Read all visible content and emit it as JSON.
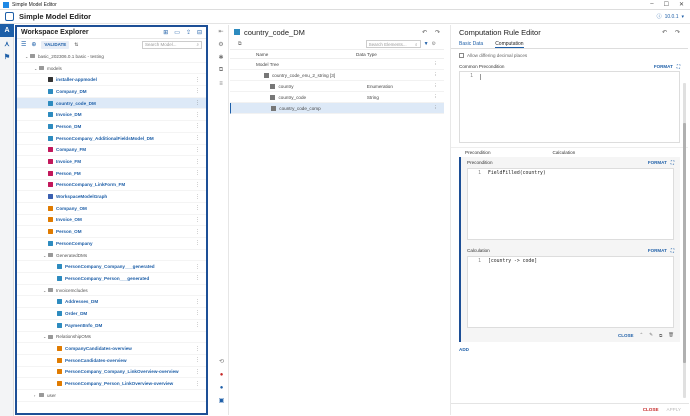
{
  "window": {
    "title": "Simple Model Editor"
  },
  "app": {
    "name": "Simple Model Editor",
    "version": "10.0.1"
  },
  "explorer": {
    "title": "Workspace Explorer",
    "validate_label": "VALIDATE",
    "search_placeholder": "Search Model...",
    "rows": [
      {
        "label": "basic_202306.0.1 basic - testing",
        "type": "folder",
        "depth": 0,
        "plain": true
      },
      {
        "label": "models",
        "type": "folder",
        "depth": 1,
        "plain": true
      },
      {
        "label": "installer-appmodel",
        "type": "app",
        "depth": 2
      },
      {
        "label": "Company_DM",
        "type": "dm",
        "depth": 2
      },
      {
        "label": "country_code_DM",
        "type": "dm",
        "depth": 2,
        "selected": true
      },
      {
        "label": "Invoice_DM",
        "type": "dm",
        "depth": 2
      },
      {
        "label": "Person_DM",
        "type": "dm",
        "depth": 2
      },
      {
        "label": "PersonCompany_AdditionalFieldsModel_DM",
        "type": "dm",
        "depth": 2
      },
      {
        "label": "Company_FM",
        "type": "fm",
        "depth": 2
      },
      {
        "label": "Invoice_FM",
        "type": "fm",
        "depth": 2
      },
      {
        "label": "Person_FM",
        "type": "fm",
        "depth": 2
      },
      {
        "label": "PersonCompany_LinkForm_FM",
        "type": "fm",
        "depth": 2
      },
      {
        "label": "WorkspaceModelGraph",
        "type": "graph",
        "depth": 2
      },
      {
        "label": "Company_OM",
        "type": "ov",
        "depth": 2
      },
      {
        "label": "Invoice_OM",
        "type": "ov",
        "depth": 2
      },
      {
        "label": "Person_OM",
        "type": "ov",
        "depth": 2
      },
      {
        "label": "PersonCompany",
        "type": "dm",
        "depth": 2
      },
      {
        "label": "GeneratedDMs",
        "type": "folder",
        "depth": 2,
        "plain": true
      },
      {
        "label": "PersonCompany_Company___generated",
        "type": "dm",
        "depth": 3
      },
      {
        "label": "PersonCompany_Person___generated",
        "type": "dm",
        "depth": 3
      },
      {
        "label": "InvoiceIncludes",
        "type": "folder",
        "depth": 2,
        "plain": true
      },
      {
        "label": "Addresses_DM",
        "type": "dm",
        "depth": 3
      },
      {
        "label": "Order_DM",
        "type": "dm",
        "depth": 3
      },
      {
        "label": "PaymentInfo_DM",
        "type": "dm",
        "depth": 3
      },
      {
        "label": "RelationshipOMs",
        "type": "folder",
        "depth": 2,
        "plain": true
      },
      {
        "label": "CompanyCandidates-overview",
        "type": "ov",
        "depth": 3
      },
      {
        "label": "PersonCandidates-overview",
        "type": "ov",
        "depth": 3
      },
      {
        "label": "PersonCompany_Company_LinkOverview-overview",
        "type": "ov",
        "depth": 3
      },
      {
        "label": "PersonCompany_Person_LinkOverview-overview",
        "type": "ov",
        "depth": 3
      },
      {
        "label": "user",
        "type": "folder",
        "depth": 1,
        "plain": true
      }
    ]
  },
  "model": {
    "title": "country_code_DM",
    "search_placeholder": "Search Elements...",
    "col_name": "Name",
    "col_type": "Data Type",
    "tree_label": "Model Tree",
    "rows": [
      {
        "name": "country_code_enu_2_string [3]",
        "type": "",
        "indent": 1
      },
      {
        "name": "country",
        "type": "Enumeration",
        "indent": 2
      },
      {
        "name": "country_code",
        "type": "String",
        "indent": 2
      },
      {
        "name": "country_code_comp",
        "type": "",
        "indent": 2,
        "selected": true
      }
    ]
  },
  "rule": {
    "title": "Computation Rule Editor",
    "tab_basic": "Basic Data",
    "tab_computation": "Computation",
    "allow_decimal": "Allow differing decimal places",
    "common_precondition": "Common Precondition",
    "format_label": "FORMAT",
    "line1": "1",
    "subtab_precondition": "Precondition",
    "subtab_calculation": "Calculation",
    "precondition_label": "Precondition",
    "precondition_code": "FieldFilled(country)",
    "calculation_label": "Calculation",
    "calculation_code": "[country -> code]",
    "close_label": "CLOSE",
    "add_label": "ADD",
    "bottom_close": "CLOSE",
    "bottom_apply": "APPLY"
  }
}
